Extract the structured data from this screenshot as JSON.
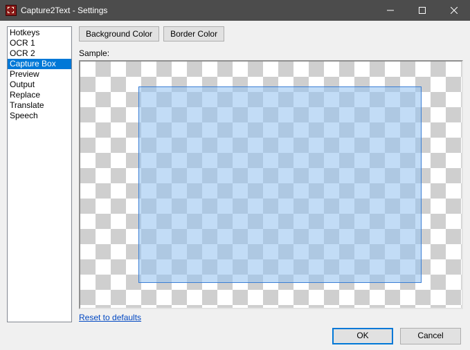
{
  "window": {
    "title": "Capture2Text - Settings"
  },
  "sidebar": {
    "items": [
      {
        "label": "Hotkeys",
        "selected": false
      },
      {
        "label": "OCR 1",
        "selected": false
      },
      {
        "label": "OCR 2",
        "selected": false
      },
      {
        "label": "Capture Box",
        "selected": true
      },
      {
        "label": "Preview",
        "selected": false
      },
      {
        "label": "Output",
        "selected": false
      },
      {
        "label": "Replace",
        "selected": false
      },
      {
        "label": "Translate",
        "selected": false
      },
      {
        "label": "Speech",
        "selected": false
      }
    ]
  },
  "main": {
    "bg_color_btn": "Background Color",
    "border_color_btn": "Border Color",
    "sample_label": "Sample:",
    "reset_link": "Reset to defaults",
    "capture_box": {
      "fill_color": "#a9cdf0",
      "border_color": "#3a7dd4",
      "opacity": 0.58
    }
  },
  "footer": {
    "ok": "OK",
    "cancel": "Cancel"
  }
}
